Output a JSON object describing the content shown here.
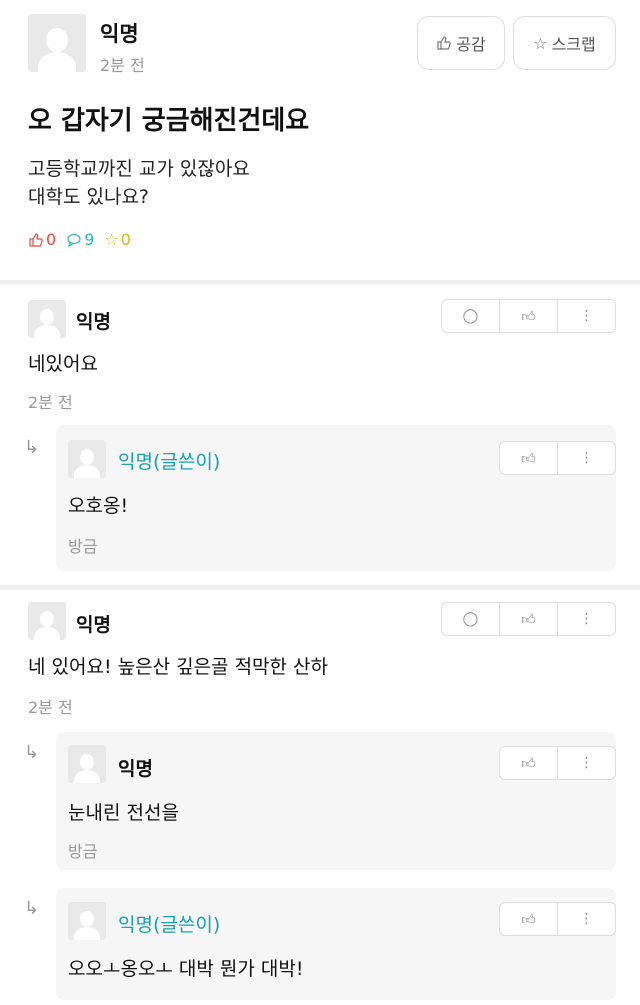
{
  "post": {
    "author": "익명",
    "time": "2분 전",
    "like_button": "공감",
    "scrap_button": "스크랩",
    "title": "오 갑자기 궁금해진건데요",
    "body_lines": [
      "고등학교까진 교가 있잖아요",
      "대학도 있나요?"
    ],
    "stats": {
      "likes": "0",
      "comments": "9",
      "scraps": "0"
    }
  },
  "comments": [
    {
      "author": "익명",
      "text": "네있어요",
      "time": "2분 전",
      "reply": {
        "author": "익명(글쓴이)",
        "text": "오호옹!",
        "time": "방금"
      }
    },
    {
      "author": "익명",
      "text": "네 있어요! 높은산 깊은골 적막한 산하",
      "time": "2분 전",
      "replies": [
        {
          "author": "익명",
          "text": "눈내린 전선을",
          "time": "방금"
        },
        {
          "author": "익명(글쓴이)",
          "text": "오오ㅗ옹오ㅗ 대박 뭔가 대박!"
        }
      ]
    }
  ],
  "icons": {
    "like": "thumbs-up-icon",
    "comment": "speech-bubble-icon",
    "scrap": "star-icon",
    "more": "vertical-ellipsis-icon",
    "reply": "reply-arrow-icon"
  },
  "colors": {
    "op_name": "#16a1b0",
    "like": "#e04c3a",
    "comment": "#2bb3c0",
    "scrap": "#e4b21b"
  }
}
